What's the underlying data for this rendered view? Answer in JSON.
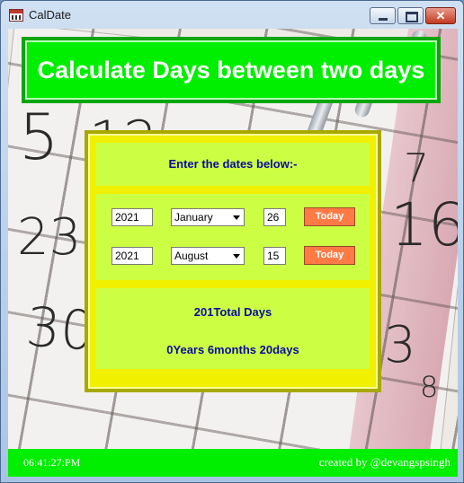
{
  "window": {
    "title": "CalDate",
    "close_glyph": "✕"
  },
  "banner": {
    "title": "Calculate Days between two days"
  },
  "form": {
    "prompt": "Enter the dates below:-",
    "date1": {
      "year": "2021",
      "month": "January",
      "day": "26",
      "today_label": "Today"
    },
    "date2": {
      "year": "2021",
      "month": "August",
      "day": "15",
      "today_label": "Today"
    }
  },
  "results": {
    "total_days": "201Total Days",
    "breakdown": "0Years 6months 20days"
  },
  "statusbar": {
    "clock": "06:41:27:PM",
    "credit": "created by @devangspsingh"
  },
  "background": {
    "numbers": [
      "5",
      "12",
      "16",
      "30",
      "23",
      "8",
      "7",
      "3"
    ]
  },
  "colors": {
    "banner": "#00ee00",
    "panel": "#f0f000",
    "section": "#ccff44",
    "text_accent": "#0a0aa0",
    "today_button": "#ff7a45"
  }
}
